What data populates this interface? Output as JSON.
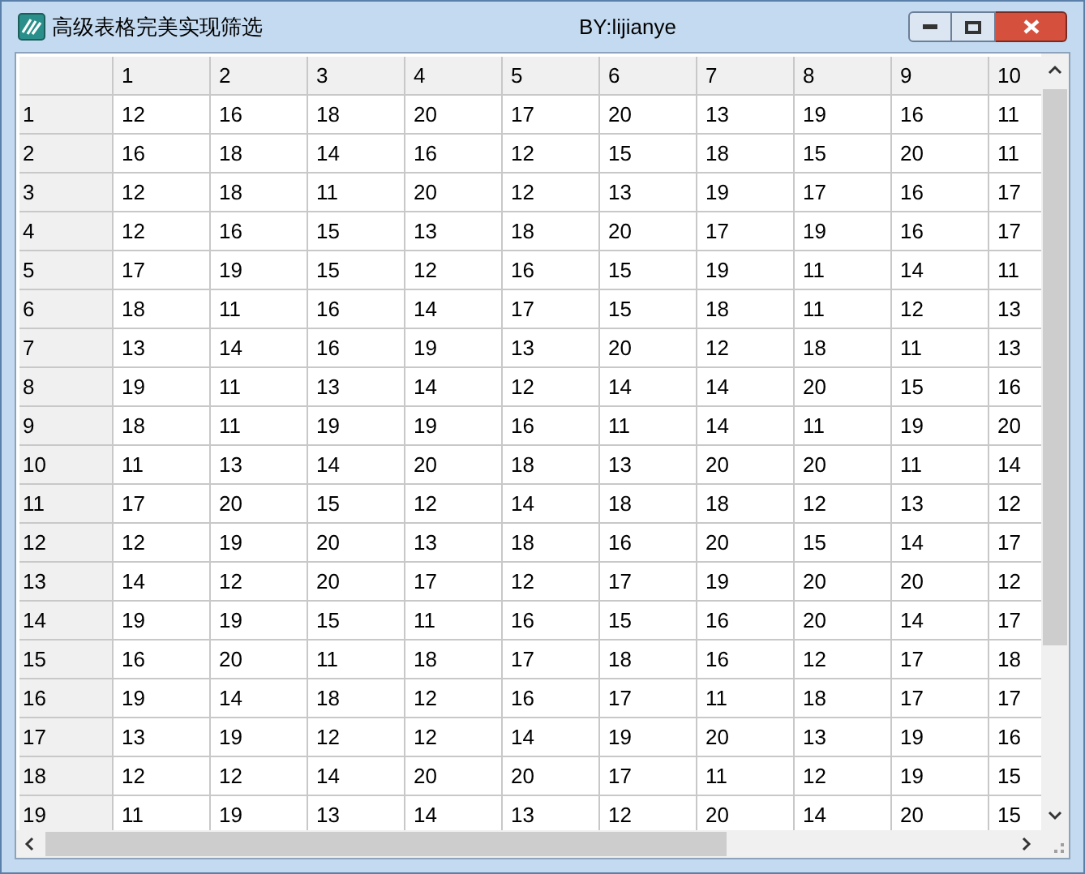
{
  "window": {
    "title": "高级表格完美实现筛选",
    "subtitle": "BY:lijianye"
  },
  "table": {
    "columns": [
      "1",
      "2",
      "3",
      "4",
      "5",
      "6",
      "7",
      "8",
      "9",
      "10"
    ],
    "rows": [
      {
        "header": "1",
        "cells": [
          "12",
          "16",
          "18",
          "20",
          "17",
          "20",
          "13",
          "19",
          "16",
          "11"
        ]
      },
      {
        "header": "2",
        "cells": [
          "16",
          "18",
          "14",
          "16",
          "12",
          "15",
          "18",
          "15",
          "20",
          "11"
        ]
      },
      {
        "header": "3",
        "cells": [
          "12",
          "18",
          "11",
          "20",
          "12",
          "13",
          "19",
          "17",
          "16",
          "17"
        ]
      },
      {
        "header": "4",
        "cells": [
          "12",
          "16",
          "15",
          "13",
          "18",
          "20",
          "17",
          "19",
          "16",
          "17"
        ]
      },
      {
        "header": "5",
        "cells": [
          "17",
          "19",
          "15",
          "12",
          "16",
          "15",
          "19",
          "11",
          "14",
          "11"
        ]
      },
      {
        "header": "6",
        "cells": [
          "18",
          "11",
          "16",
          "14",
          "17",
          "15",
          "18",
          "11",
          "12",
          "13"
        ]
      },
      {
        "header": "7",
        "cells": [
          "13",
          "14",
          "16",
          "19",
          "13",
          "20",
          "12",
          "18",
          "11",
          "13"
        ]
      },
      {
        "header": "8",
        "cells": [
          "19",
          "11",
          "13",
          "14",
          "12",
          "14",
          "14",
          "20",
          "15",
          "16"
        ]
      },
      {
        "header": "9",
        "cells": [
          "18",
          "11",
          "19",
          "19",
          "16",
          "11",
          "14",
          "11",
          "19",
          "20"
        ]
      },
      {
        "header": "10",
        "cells": [
          "11",
          "13",
          "14",
          "20",
          "18",
          "13",
          "20",
          "20",
          "11",
          "14"
        ]
      },
      {
        "header": "11",
        "cells": [
          "17",
          "20",
          "15",
          "12",
          "14",
          "18",
          "18",
          "12",
          "13",
          "12"
        ]
      },
      {
        "header": "12",
        "cells": [
          "12",
          "19",
          "20",
          "13",
          "18",
          "16",
          "20",
          "15",
          "14",
          "17"
        ]
      },
      {
        "header": "13",
        "cells": [
          "14",
          "12",
          "20",
          "17",
          "12",
          "17",
          "19",
          "20",
          "20",
          "12"
        ]
      },
      {
        "header": "14",
        "cells": [
          "19",
          "19",
          "15",
          "11",
          "16",
          "15",
          "16",
          "20",
          "14",
          "17"
        ]
      },
      {
        "header": "15",
        "cells": [
          "16",
          "20",
          "11",
          "18",
          "17",
          "18",
          "16",
          "12",
          "17",
          "18"
        ]
      },
      {
        "header": "16",
        "cells": [
          "19",
          "14",
          "18",
          "12",
          "16",
          "17",
          "11",
          "18",
          "17",
          "17"
        ]
      },
      {
        "header": "17",
        "cells": [
          "13",
          "19",
          "12",
          "12",
          "14",
          "19",
          "20",
          "13",
          "19",
          "16"
        ]
      },
      {
        "header": "18",
        "cells": [
          "12",
          "12",
          "14",
          "20",
          "20",
          "17",
          "11",
          "12",
          "19",
          "15"
        ]
      },
      {
        "header": "19",
        "cells": [
          "11",
          "19",
          "13",
          "14",
          "13",
          "12",
          "20",
          "14",
          "20",
          "15"
        ]
      }
    ]
  }
}
